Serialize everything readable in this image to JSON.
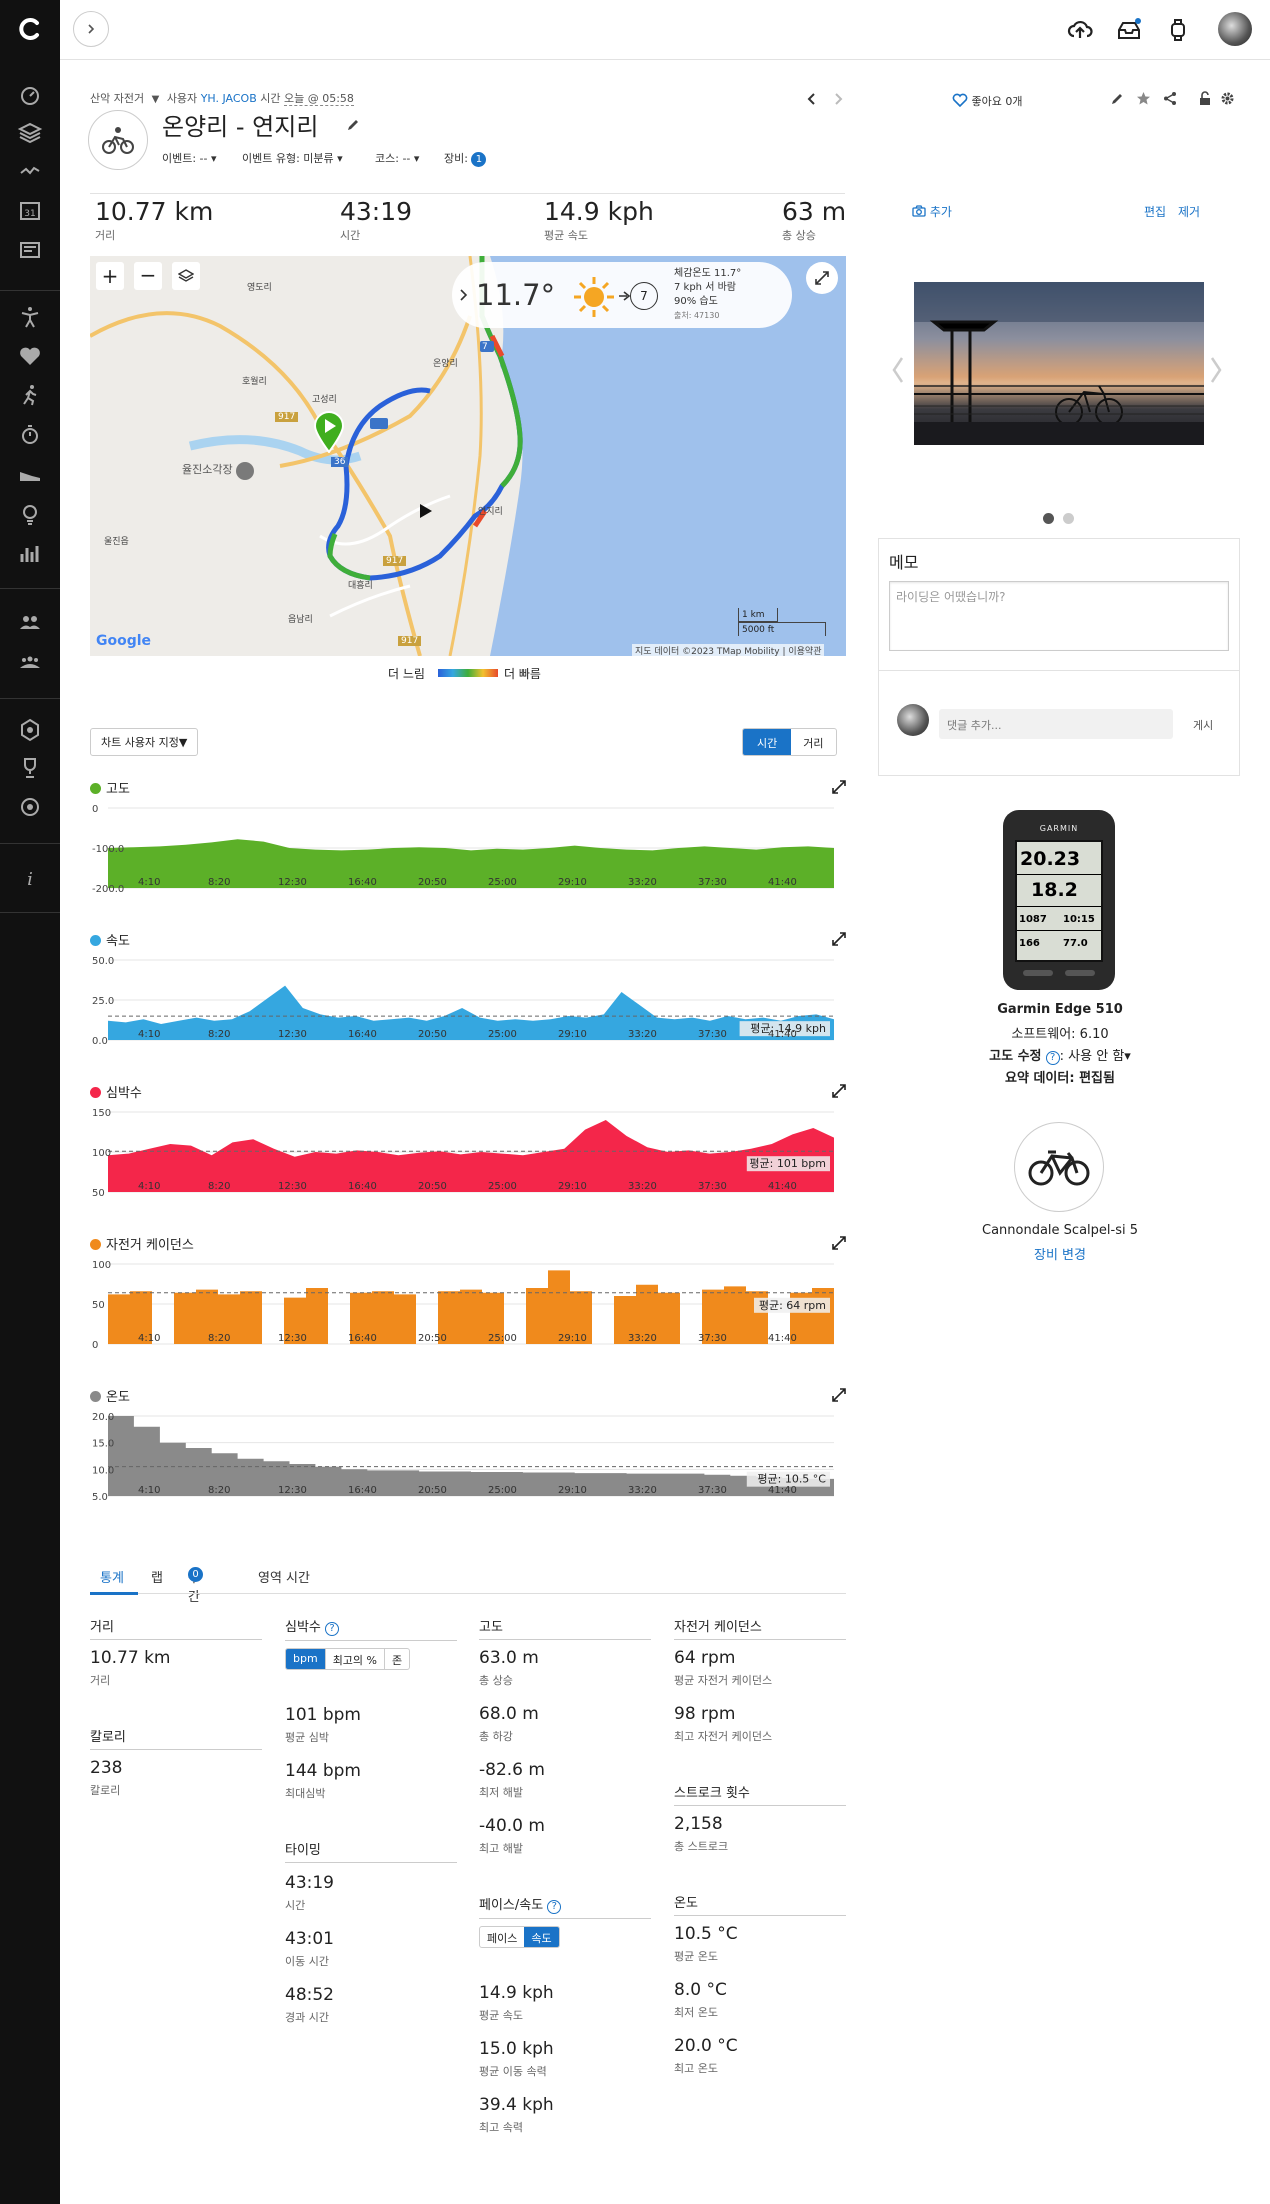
{
  "header": {
    "breadcrumb": {
      "activity_type": "산악 자전거",
      "user_label": "사용자",
      "user": "YH. JACOB",
      "time_label": "시간",
      "time": "오늘 @ 05:58"
    },
    "title": "온양리 - 연지리",
    "event_label": "이벤트: --",
    "event_type_label": "이벤트 유형: 미분류",
    "course_label": "코스: --",
    "gear_label": "장비:",
    "gear_count": "1",
    "likes": "좋아요 0개"
  },
  "stats_top": [
    {
      "value": "10.77 km",
      "label": "거리"
    },
    {
      "value": "43:19",
      "label": "시간"
    },
    {
      "value": "14.9 kph",
      "label": "평균 속도"
    },
    {
      "value": "63 m",
      "label": "총 상승"
    }
  ],
  "weather": {
    "temp": "11.7°",
    "feels": "체감온도 11.7°",
    "wind": "7 kph 서 바람",
    "humidity": "90% 습도",
    "source": "출처: 47130",
    "wind_speed_badge": "7"
  },
  "map": {
    "labels": [
      "영도리",
      "온양리",
      "고성리",
      "연지리",
      "읍남리",
      "율진소각장",
      "울진읍",
      "호월리",
      "대흥리"
    ],
    "route_numbers": [
      "917",
      "36",
      "7",
      "917",
      "917"
    ],
    "scale_km": "1 km",
    "scale_ft": "5000 ft",
    "attribution": "지도 데이터 ©2023 TMap Mobility",
    "terms": "이용약관",
    "google": "Google",
    "legend_slow": "더 느림",
    "legend_fast": "더 빠름"
  },
  "chart_controls": {
    "customize": "차트 사용자 지정",
    "time": "시간",
    "distance": "거리"
  },
  "colors": {
    "elevation": "#5cb028",
    "speed": "#35a7e0",
    "heart": "#f4264a",
    "cadence": "#f08a1c",
    "temp": "#8a8a8a",
    "accent": "#1a73c7"
  },
  "chart_data": [
    {
      "type": "area",
      "title": "고도",
      "x": [
        "4:10",
        "8:20",
        "12:30",
        "16:40",
        "20:50",
        "25:00",
        "29:10",
        "33:20",
        "37:30",
        "41:40"
      ],
      "y_ticks": [
        "0",
        "-100.0",
        "-200.0"
      ],
      "values": [
        -100,
        -98,
        -96,
        -92,
        -86,
        -78,
        -84,
        -100,
        -104,
        -106,
        -104,
        -100,
        -98,
        -100,
        -106,
        -102,
        -104,
        -100,
        -94,
        -100,
        -104,
        -106,
        -100,
        -96,
        -100,
        -104,
        -98,
        -96,
        -100
      ],
      "ylim": [
        -200,
        0
      ]
    },
    {
      "type": "area",
      "title": "속도",
      "x": [
        "4:10",
        "8:20",
        "12:30",
        "16:40",
        "20:50",
        "25:00",
        "29:10",
        "33:20",
        "37:30",
        "41:40"
      ],
      "y_ticks": [
        "50.0",
        "25.0",
        "0.0"
      ],
      "avg_label": "평균: 14.9 kph",
      "avg": 14.9,
      "values": [
        12,
        11,
        13,
        10,
        12,
        14,
        12,
        13,
        18,
        26,
        34,
        20,
        16,
        14,
        15,
        12,
        13,
        14,
        12,
        15,
        20,
        14,
        12,
        13,
        12,
        13,
        15,
        14,
        16,
        30,
        22,
        14,
        13,
        14,
        12,
        15,
        13,
        14,
        12,
        15,
        16,
        13
      ],
      "ylim": [
        0,
        50
      ]
    },
    {
      "type": "area",
      "title": "심박수",
      "x": [
        "4:10",
        "8:20",
        "12:30",
        "16:40",
        "20:50",
        "25:00",
        "29:10",
        "33:20",
        "37:30",
        "41:40"
      ],
      "y_ticks": [
        "150",
        "100",
        "50"
      ],
      "avg_label": "평균: 101 bpm",
      "avg": 101,
      "values": [
        96,
        98,
        104,
        110,
        108,
        96,
        112,
        116,
        104,
        94,
        100,
        98,
        102,
        100,
        96,
        99,
        101,
        97,
        100,
        98,
        96,
        100,
        104,
        128,
        140,
        120,
        106,
        100,
        102,
        98,
        100,
        104,
        110,
        122,
        130,
        118
      ],
      "ylim": [
        50,
        150
      ]
    },
    {
      "type": "area",
      "title": "자전거 케이던스",
      "x": [
        "4:10",
        "8:20",
        "12:30",
        "16:40",
        "20:50",
        "25:00",
        "29:10",
        "33:20",
        "37:30",
        "41:40"
      ],
      "y_ticks": [
        "100",
        "50",
        "0"
      ],
      "avg_label": "평균: 64 rpm",
      "avg": 64,
      "values": [
        62,
        66,
        0,
        64,
        68,
        62,
        66,
        0,
        58,
        70,
        0,
        64,
        66,
        62,
        0,
        66,
        68,
        64,
        0,
        70,
        92,
        66,
        0,
        60,
        74,
        64,
        0,
        68,
        72,
        66,
        0,
        64,
        70
      ],
      "ylim": [
        0,
        100
      ]
    },
    {
      "type": "area",
      "title": "온도",
      "x": [
        "4:10",
        "8:20",
        "12:30",
        "16:40",
        "20:50",
        "25:00",
        "29:10",
        "33:20",
        "37:30",
        "41:40"
      ],
      "y_ticks": [
        "20.0",
        "15.0",
        "10.0",
        "5.0"
      ],
      "avg_label": "평균: 10.5 °C",
      "avg": 10.5,
      "values": [
        20,
        18,
        15,
        14,
        13,
        12,
        11.5,
        11,
        10.5,
        10,
        9.8,
        9.8,
        9.6,
        9.6,
        9.5,
        9.5,
        9.4,
        9.4,
        9.3,
        9.3,
        9.2,
        9.2,
        9.2,
        9,
        8.8,
        8.6,
        8.4,
        8.2
      ],
      "ylim": [
        5,
        20
      ]
    }
  ],
  "stat_tabs": [
    "통계",
    "랩",
    "구간",
    "영역 시간"
  ],
  "segments_count": "0",
  "stats": {
    "distance": {
      "title": "거리",
      "value": "10.77 km",
      "label": "거리"
    },
    "calories": {
      "title": "칼로리",
      "value": "238",
      "label": "칼로리"
    },
    "heart": {
      "title": "심박수",
      "toggle": [
        "bpm",
        "최고의 %",
        "존"
      ],
      "items": [
        {
          "value": "101 bpm",
          "label": "평균 심박"
        },
        {
          "value": "144 bpm",
          "label": "최대심박"
        }
      ]
    },
    "timing": {
      "title": "타이밍",
      "items": [
        {
          "value": "43:19",
          "label": "시간"
        },
        {
          "value": "43:01",
          "label": "이동 시간"
        },
        {
          "value": "48:52",
          "label": "경과 시간"
        }
      ]
    },
    "elevation": {
      "title": "고도",
      "items": [
        {
          "value": "63.0 m",
          "label": "총 상승"
        },
        {
          "value": "68.0 m",
          "label": "총 하강"
        },
        {
          "value": "-82.6 m",
          "label": "최저 해발"
        },
        {
          "value": "-40.0 m",
          "label": "최고 해발"
        }
      ]
    },
    "pace": {
      "title": "페이스/속도",
      "toggle": [
        "페이스",
        "속도"
      ],
      "items": [
        {
          "value": "14.9 kph",
          "label": "평균 속도"
        },
        {
          "value": "15.0 kph",
          "label": "평균 이동 속력"
        },
        {
          "value": "39.4 kph",
          "label": "최고 속력"
        }
      ]
    },
    "cadence": {
      "title": "자전거 케이던스",
      "items": [
        {
          "value": "64 rpm",
          "label": "평균 자전거 케이던스"
        },
        {
          "value": "98 rpm",
          "label": "최고 자전거 케이던스"
        }
      ]
    },
    "strokes": {
      "title": "스트로크 횟수",
      "items": [
        {
          "value": "2,158",
          "label": "총 스트로크"
        }
      ]
    },
    "temperature": {
      "title": "온도",
      "items": [
        {
          "value": "10.5 °C",
          "label": "평균 온도"
        },
        {
          "value": "8.0 °C",
          "label": "최저 온도"
        },
        {
          "value": "20.0 °C",
          "label": "최고 온도"
        }
      ]
    }
  },
  "right": {
    "photo_add": "추가",
    "edit": "편집",
    "remove": "제거",
    "memo_title": "메모",
    "memo_placeholder": "라이딩은 어땠습니까?",
    "comment_placeholder": "댓글 추가...",
    "post": "게시",
    "device": {
      "name": "Garmin Edge 510",
      "software": "소프트웨어: 6.10",
      "elev_corr_label": "고도 수정",
      "elev_corr_value": ": 사용 안 함",
      "summary": "요약 데이터: 편집됨",
      "screen": {
        "brand": "GARMIN",
        "distance": "20.23",
        "speed": "18.2",
        "cells": [
          "1087",
          "10:15",
          "166",
          "77.0"
        ]
      }
    },
    "bike": {
      "name": "Cannondale Scalpel-si 5",
      "change": "장비 변경"
    }
  }
}
